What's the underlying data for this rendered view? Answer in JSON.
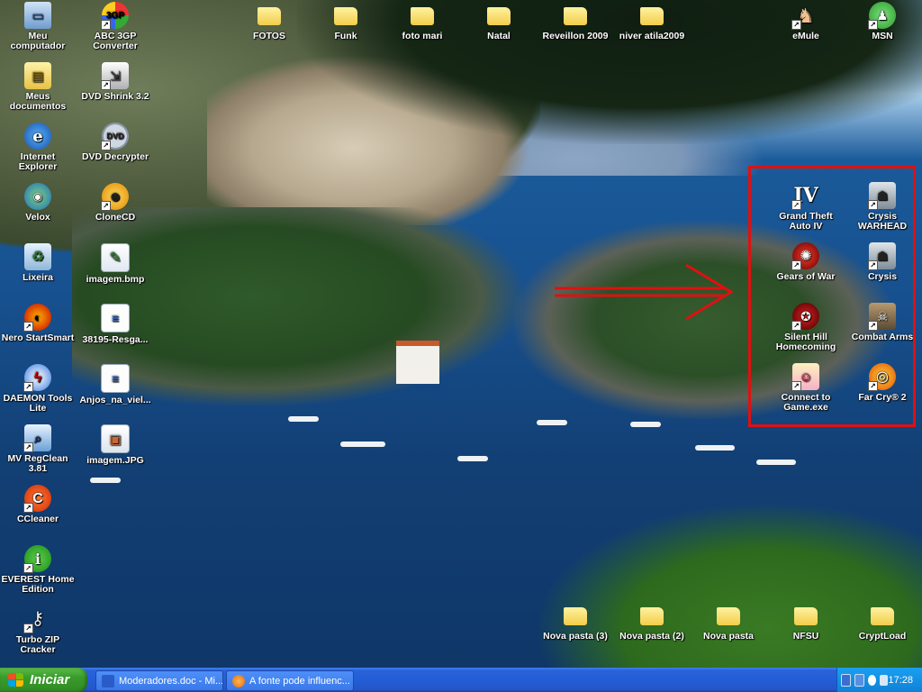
{
  "desktop": {
    "icons_left_col1": [
      {
        "label": "Meu computador",
        "icon": "my-computer-icon",
        "glyph": "▭",
        "cls": "g-computer",
        "shortcut": false
      },
      {
        "label": "Meus documentos",
        "icon": "my-documents-icon",
        "glyph": "▤",
        "cls": "g-mydocs",
        "shortcut": false
      },
      {
        "label": "Internet Explorer",
        "icon": "internet-explorer-icon",
        "glyph": "e",
        "cls": "g-ie",
        "shortcut": false
      },
      {
        "label": "Velox",
        "icon": "velox-icon",
        "glyph": "◉",
        "cls": "g-velox",
        "shortcut": false
      },
      {
        "label": "Lixeira",
        "icon": "recycle-bin-icon",
        "glyph": "♻",
        "cls": "g-trash",
        "shortcut": false
      },
      {
        "label": "Nero StartSmart",
        "icon": "nero-icon",
        "glyph": "◐",
        "cls": "g-nero",
        "shortcut": true
      },
      {
        "label": "DAEMON Tools Lite",
        "icon": "daemon-tools-icon",
        "glyph": "ϟ",
        "cls": "g-daemon",
        "shortcut": true
      },
      {
        "label": "MV RegClean 3.81",
        "icon": "regclean-icon",
        "glyph": "⌕",
        "cls": "g-regclean",
        "shortcut": true
      },
      {
        "label": "CCleaner",
        "icon": "ccleaner-icon",
        "glyph": "C",
        "cls": "g-ccleaner",
        "shortcut": true
      },
      {
        "label": "EVEREST Home Edition",
        "icon": "everest-icon",
        "glyph": "i",
        "cls": "g-everest",
        "shortcut": true
      },
      {
        "label": "Turbo ZIP Cracker",
        "icon": "key-icon",
        "glyph": "⚷",
        "cls": "g-zip",
        "shortcut": true
      }
    ],
    "icons_left_col2": [
      {
        "label": "ABC 3GP Converter",
        "icon": "abc-3gp-converter-icon",
        "glyph": "3GP",
        "cls": "g-abc",
        "shortcut": true
      },
      {
        "label": "DVD Shrink 3.2",
        "icon": "dvd-shrink-icon",
        "glyph": "⇲",
        "cls": "g-shrink",
        "shortcut": true
      },
      {
        "label": "DVD Decrypter",
        "icon": "dvd-decrypter-icon",
        "glyph": "DVD",
        "cls": "g-dvd",
        "shortcut": true
      },
      {
        "label": "CloneCD",
        "icon": "clonecd-icon",
        "glyph": "☻",
        "cls": "g-clonecd",
        "shortcut": true
      },
      {
        "label": "imagem.bmp",
        "icon": "bitmap-file-icon",
        "glyph": "✎",
        "cls": "g-bmp",
        "shortcut": false
      },
      {
        "label": "38195-Resga...",
        "icon": "document-file-icon",
        "glyph": "≡",
        "cls": "g-doc",
        "shortcut": false
      },
      {
        "label": "Anjos_na_viel...",
        "icon": "document-file-icon",
        "glyph": "≡",
        "cls": "g-doc",
        "shortcut": false
      },
      {
        "label": "imagem.JPG",
        "icon": "jpg-file-icon",
        "glyph": "▣",
        "cls": "g-jpg",
        "shortcut": false
      }
    ],
    "icons_top_folders": [
      {
        "label": "FOTOS"
      },
      {
        "label": "Funk"
      },
      {
        "label": "foto mari"
      },
      {
        "label": "Natal"
      },
      {
        "label": "Reveillon 2009"
      },
      {
        "label": "niver atila2009"
      }
    ],
    "icons_top_right": [
      {
        "label": "eMule",
        "icon": "emule-icon",
        "glyph": "♞",
        "cls": "g-emule",
        "shortcut": true
      },
      {
        "label": "MSN",
        "icon": "msn-icon",
        "glyph": "♟",
        "cls": "g-msn",
        "shortcut": true
      }
    ],
    "games_col1": [
      {
        "label": "Grand Theft Auto IV",
        "icon": "gta-iv-icon",
        "glyph": "IV",
        "cls": "g-gta",
        "shortcut": true
      },
      {
        "label": "Gears of War",
        "icon": "gears-of-war-icon",
        "glyph": "✺",
        "cls": "g-gears",
        "shortcut": true
      },
      {
        "label": "Silent Hill Homecoming",
        "icon": "silent-hill-icon",
        "glyph": "✪",
        "cls": "g-silent",
        "shortcut": true
      },
      {
        "label": "Connect to Game.exe",
        "icon": "connect-to-game-icon",
        "glyph": "☺",
        "cls": "g-connect",
        "shortcut": true
      }
    ],
    "games_col2": [
      {
        "label": "Crysis WARHEAD",
        "icon": "crysis-warhead-icon",
        "glyph": "☗",
        "cls": "g-crysis",
        "shortcut": true
      },
      {
        "label": "Crysis",
        "icon": "crysis-icon",
        "glyph": "☗",
        "cls": "g-crysis",
        "shortcut": true
      },
      {
        "label": "Combat Arms",
        "icon": "combat-arms-icon",
        "glyph": "☠",
        "cls": "g-combat",
        "shortcut": true
      },
      {
        "label": "Far Cry® 2",
        "icon": "far-cry-2-icon",
        "glyph": "◎",
        "cls": "g-farcry",
        "shortcut": true
      }
    ],
    "icons_bottom_folders": [
      {
        "label": "Nova pasta (3)"
      },
      {
        "label": "Nova pasta (2)"
      },
      {
        "label": "Nova pasta"
      },
      {
        "label": "NFSU"
      },
      {
        "label": "CryptLoad"
      }
    ],
    "annotation_color": "#e01010"
  },
  "taskbar": {
    "start_label": "Iniciar",
    "tasks": [
      {
        "label": "Moderadores.doc - Mi...",
        "icon": "word-doc-icon",
        "color": "#2a5cc8"
      },
      {
        "label": "A fonte pode influenc...",
        "icon": "firefox-icon",
        "color": "#e0681a"
      }
    ],
    "clock": "17:28"
  }
}
